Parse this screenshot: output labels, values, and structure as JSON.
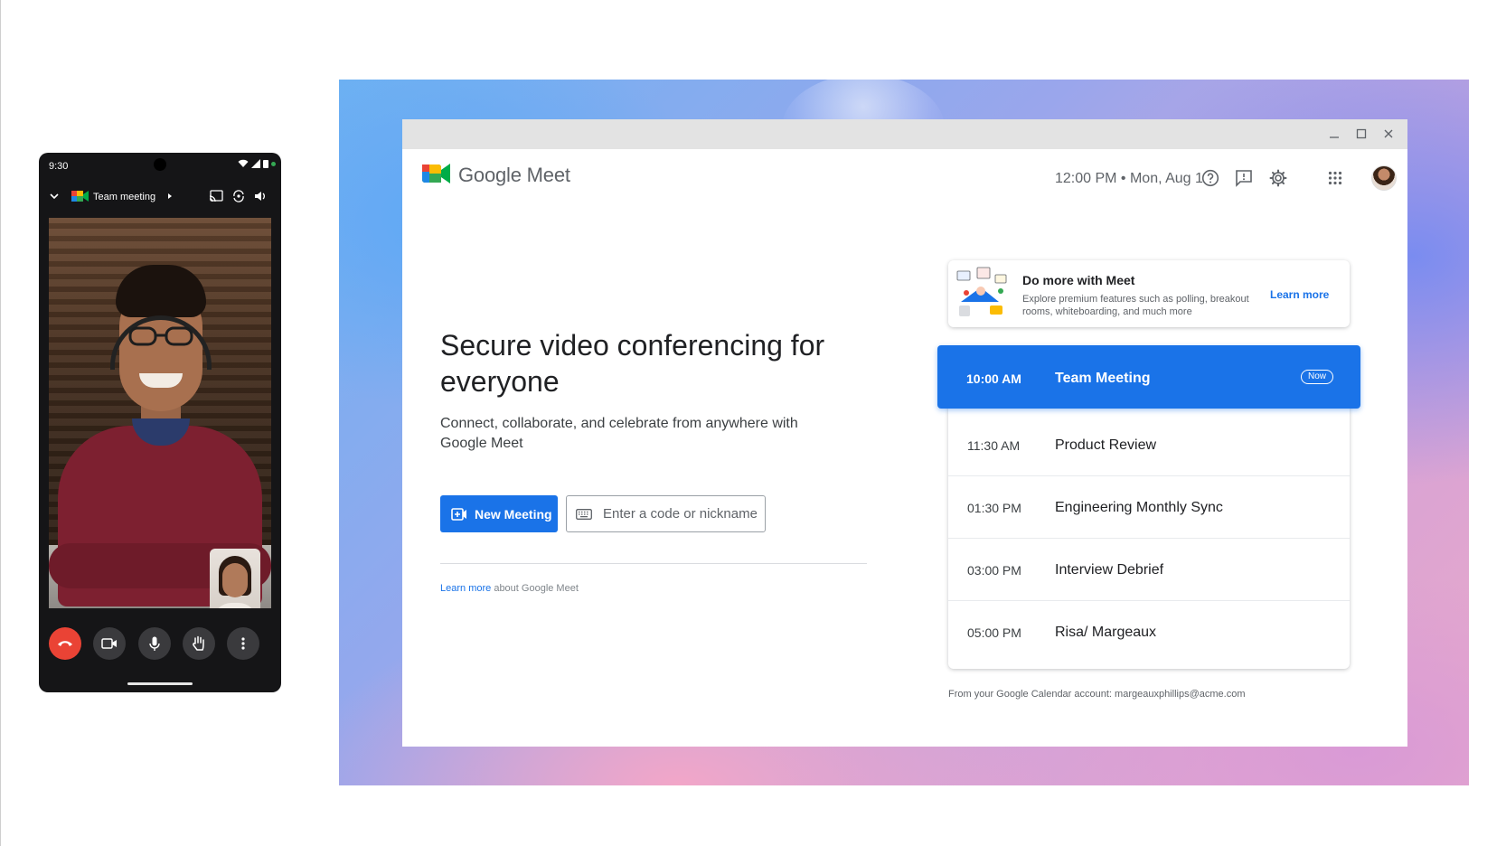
{
  "phone": {
    "status_time": "9:30",
    "call_title": "Team meeting",
    "icons": [
      "wifi-icon",
      "signal-icon",
      "battery-icon",
      "chevron-down-icon",
      "meet-logo-icon",
      "caret-right-icon",
      "cast-icon",
      "switch-camera-icon",
      "volume-icon"
    ],
    "controls": [
      "end-call-icon",
      "camera-icon",
      "microphone-icon",
      "raise-hand-icon",
      "more-vert-icon"
    ],
    "colors": {
      "end_call": "#ea4335",
      "control_bg": "#3a3a3d"
    }
  },
  "app": {
    "name": "Google Meet",
    "datetime": "12:00 PM • Mon, Aug 1",
    "header_icons": [
      "help-icon",
      "feedback-icon",
      "settings-icon",
      "apps-grid-icon",
      "avatar"
    ],
    "window_controls": [
      "minimize-icon",
      "maximize-icon",
      "close-icon"
    ],
    "accent": "#1a73e8"
  },
  "hero": {
    "title": "Secure video conferencing for everyone",
    "subtitle": "Connect, collaborate, and celebrate from anywhere with Google Meet",
    "new_meeting_label": "New Meeting",
    "code_placeholder": "Enter a code or nickname",
    "learn_more_link": "Learn more",
    "learn_more_rest": " about Google Meet"
  },
  "promo": {
    "title": "Do more with Meet",
    "body": "Explore premium features such as polling, breakout rooms, whiteboarding, and much more",
    "link": "Learn more"
  },
  "agenda": {
    "items": [
      {
        "time": "10:00 AM",
        "title": "Team Meeting",
        "badge": "Now"
      },
      {
        "time": "11:30 AM",
        "title": "Product Review"
      },
      {
        "time": "01:30 PM",
        "title": "Engineering Monthly Sync"
      },
      {
        "time": "03:00 PM",
        "title": "Interview Debrief"
      },
      {
        "time": "05:00 PM",
        "title": "Risa/ Margeaux"
      }
    ],
    "footer": "From your Google Calendar account: margeauxphillips@acme.com"
  }
}
